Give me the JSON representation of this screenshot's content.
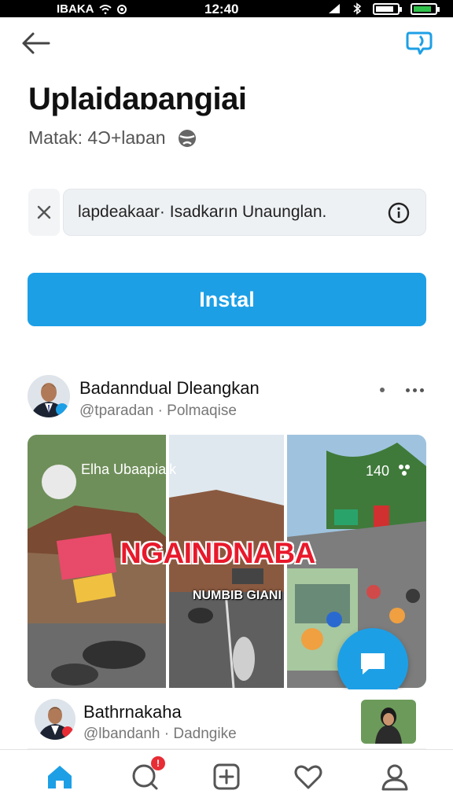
{
  "status_bar": {
    "carrier": "IBAKA",
    "time": "12:40"
  },
  "header": {
    "back_icon": "arrow-left-icon",
    "message_icon": "chat-bubble-icon",
    "title": "Uplaidaɒangiai",
    "subtitle": "Matak: 4Ɔ+laɒan"
  },
  "search": {
    "value": "lapdeakaar· Isadkarın Unaunglan."
  },
  "install_button": {
    "label": "Instal"
  },
  "post": {
    "author": "Badanndual Dleangkan",
    "handle": "@tparadan · Polmaqise",
    "media": {
      "overlay_name": "Elha Ubaapialk",
      "counter": "140",
      "headline": "NGAINDNABA",
      "subheadline": "NUMBIB GIANI"
    }
  },
  "post2": {
    "author": "Bathrnakaha",
    "handle": "@lbandanh · Dadngike"
  },
  "bottom_nav": {
    "items": [
      "home-icon",
      "notifications-icon",
      "create-icon",
      "likes-icon",
      "profile-icon"
    ],
    "notification_badge": "!"
  },
  "colors": {
    "accent": "#1d9fe6",
    "badge": "#e82c35",
    "headline": "#e8192b"
  }
}
